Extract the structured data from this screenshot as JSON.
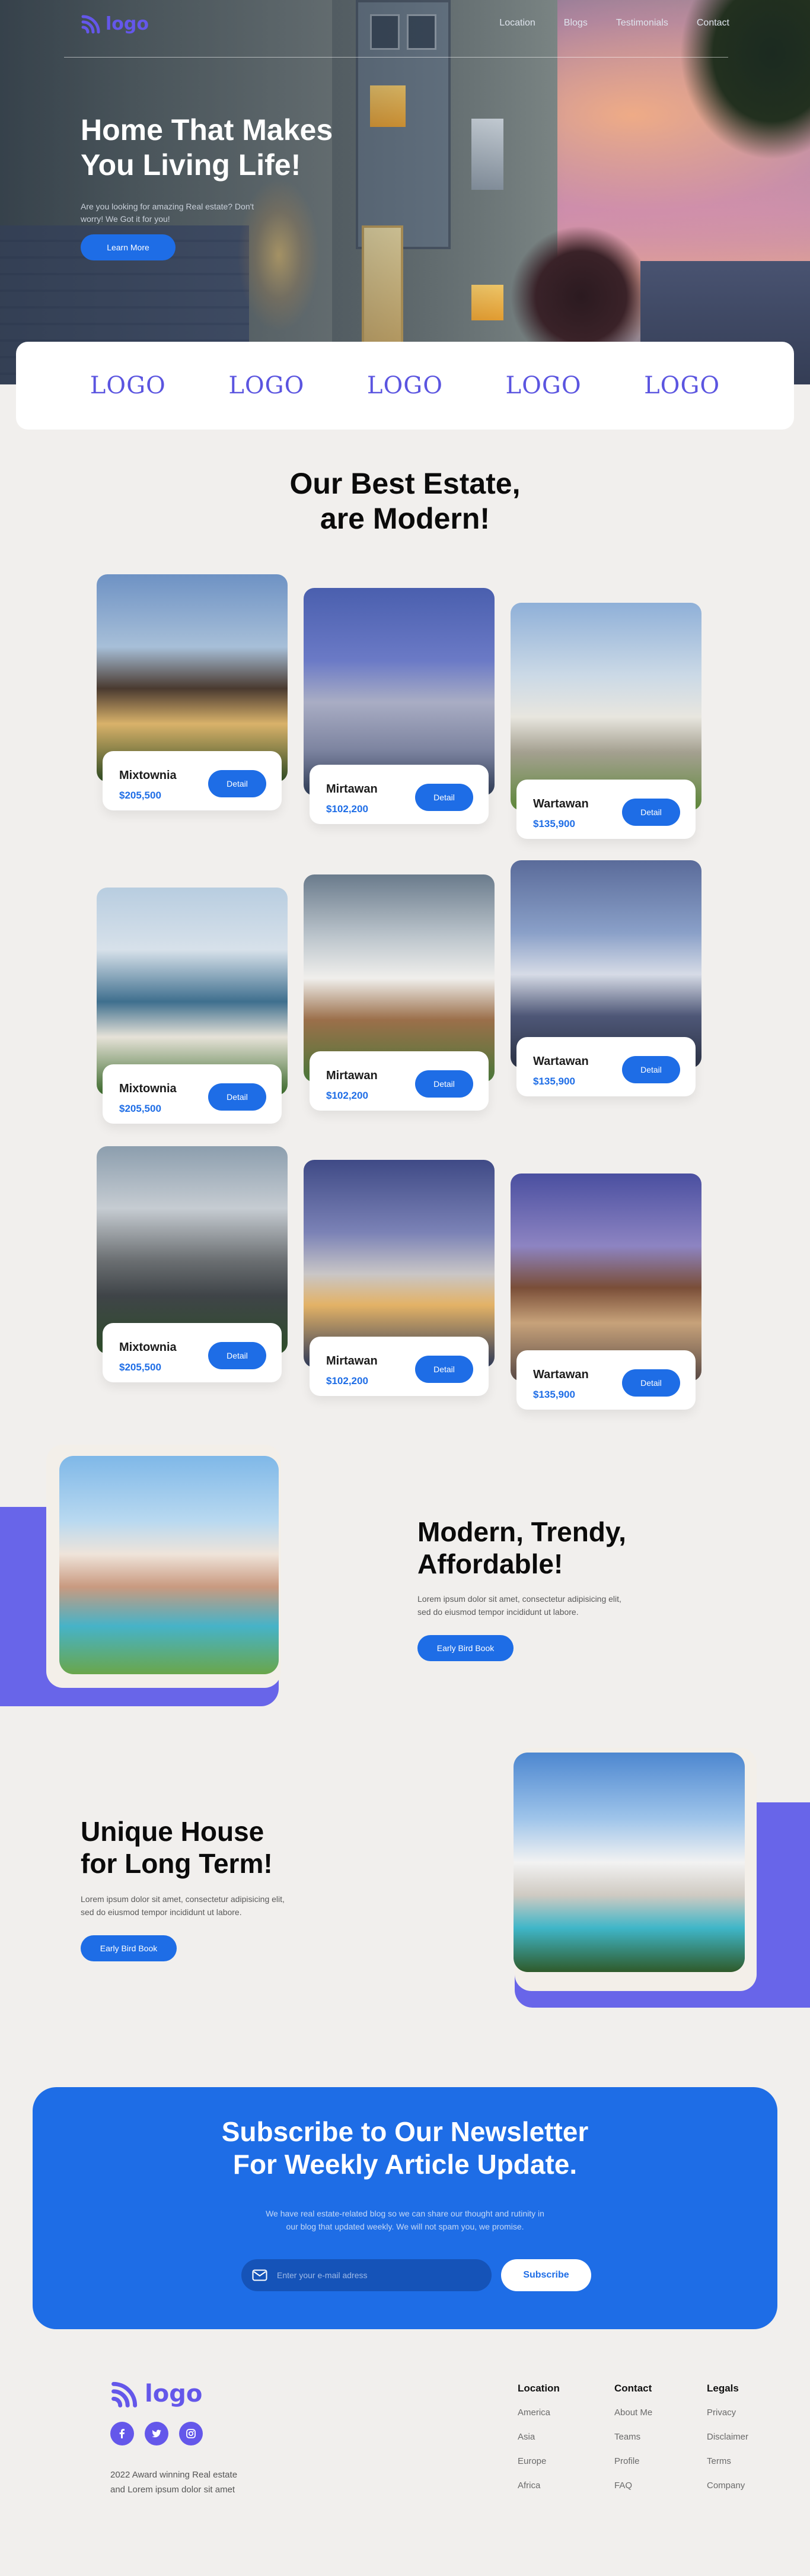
{
  "nav": {
    "logo_text": "logo",
    "links": [
      "Location",
      "Blogs",
      "Testimonials",
      "Contact"
    ]
  },
  "hero": {
    "title": "Home That Makes You Living Life!",
    "subtitle": "Are you looking for amazing Real estate? Don't worry! We Got it for you!",
    "button": "Learn More"
  },
  "partners": [
    "LOGO",
    "LOGO",
    "LOGO",
    "LOGO",
    "LOGO"
  ],
  "estates": {
    "title_line1": "Our Best Estate,",
    "title_line2": "are Modern!",
    "button": "Detail",
    "cards": [
      {
        "name": "Mixtownia",
        "price": "$205,500"
      },
      {
        "name": "Mirtawan",
        "price": "$102,200"
      },
      {
        "name": "Wartawan",
        "price": "$135,900"
      },
      {
        "name": "Mixtownia",
        "price": "$205,500"
      },
      {
        "name": "Mirtawan",
        "price": "$102,200"
      },
      {
        "name": "Wartawan",
        "price": "$135,900"
      },
      {
        "name": "Mixtownia",
        "price": "$205,500"
      },
      {
        "name": "Mirtawan",
        "price": "$102,200"
      },
      {
        "name": "Wartawan",
        "price": "$135,900"
      }
    ]
  },
  "feature1": {
    "title_line1": "Modern, Trendy,",
    "title_line2": "Affordable!",
    "text_line1": "Lorem ipsum dolor sit amet, consectetur adipisicing elit,",
    "text_line2": "sed do eiusmod tempor incididunt ut labore.",
    "button": "Early Bird Book"
  },
  "feature2": {
    "title_line1": "Unique House",
    "title_line2": "for Long Term!",
    "text_line1": "Lorem ipsum dolor sit amet, consectetur adipisicing elit,",
    "text_line2": "sed do eiusmod tempor incididunt ut labore.",
    "button": "Early Bird Book"
  },
  "newsletter": {
    "title_line1": "Subscribe to Our Newsletter",
    "title_line2": "For Weekly Article Update.",
    "text_line1": "We have real estate-related blog so we can share our thought and rutinity in",
    "text_line2": "our blog that updated weekly. We will not spam you, we promise.",
    "placeholder": "Enter your e-mail adress",
    "button": "Subscribe"
  },
  "footer": {
    "logo_text": "logo",
    "desc_line1": "2022 Award winning Real estate",
    "desc_line2": "and Lorem ipsum dolor sit amet",
    "social_icons": [
      "facebook-icon",
      "twitter-icon",
      "instagram-icon"
    ],
    "columns": [
      {
        "title": "Location",
        "links": [
          "America",
          "Asia",
          "Europe",
          "Africa"
        ]
      },
      {
        "title": "Contact",
        "links": [
          "About Me",
          "Teams",
          "Profile",
          "FAQ"
        ]
      },
      {
        "title": "Legals",
        "links": [
          "Privacy",
          "Disclaimer",
          "Terms",
          "Company"
        ]
      }
    ]
  },
  "colors": {
    "accent_blue": "#1e6de6",
    "accent_purple": "#6457ea",
    "background": "#f1efed"
  }
}
